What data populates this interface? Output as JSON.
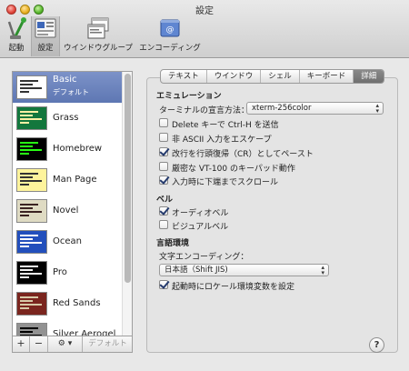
{
  "window": {
    "title": "設定"
  },
  "toolbar": {
    "items": [
      {
        "label": "起動"
      },
      {
        "label": "設定"
      },
      {
        "label": "ウインドウグループ"
      },
      {
        "label": "エンコーディング"
      }
    ]
  },
  "profiles": {
    "items": [
      {
        "name": "Basic",
        "subtitle": "デフォルト",
        "colors": {
          "bg": "#ffffff",
          "fg": "#333333"
        }
      },
      {
        "name": "Grass",
        "colors": {
          "bg": "#13773d",
          "fg": "#fff0a5"
        }
      },
      {
        "name": "Homebrew",
        "colors": {
          "bg": "#000000",
          "fg": "#28fe14"
        }
      },
      {
        "name": "Man Page",
        "colors": {
          "bg": "#fef49c",
          "fg": "#333333"
        }
      },
      {
        "name": "Novel",
        "colors": {
          "bg": "#dfdbc3",
          "fg": "#3b2322"
        }
      },
      {
        "name": "Ocean",
        "colors": {
          "bg": "#224fbc",
          "fg": "#ffffff"
        }
      },
      {
        "name": "Pro",
        "colors": {
          "bg": "#000000",
          "fg": "#f2f2f2"
        }
      },
      {
        "name": "Red Sands",
        "colors": {
          "bg": "#7a251e",
          "fg": "#d7c9a7"
        }
      },
      {
        "name": "Silver Aerogel",
        "colors": {
          "bg": "#929292",
          "fg": "#000000"
        }
      }
    ],
    "buttons": {
      "add": "+",
      "remove": "−",
      "gear": "⚙",
      "gear_arrow": "▾",
      "default": "デフォルト"
    }
  },
  "tabs": [
    {
      "label": "テキスト",
      "active": false
    },
    {
      "label": "ウインドウ",
      "active": false
    },
    {
      "label": "シェル",
      "active": false
    },
    {
      "label": "キーボード",
      "active": false
    },
    {
      "label": "詳細",
      "active": true
    }
  ],
  "emulation": {
    "heading": "エミュレーション",
    "terminal_type_label": "ターミナルの宣言方法：",
    "terminal_type_value": "xterm-256color",
    "options": [
      {
        "label": "Delete キーで Ctrl-H を送信",
        "checked": false
      },
      {
        "label": "非 ASCII 入力をエスケープ",
        "checked": false
      },
      {
        "label": "改行を行頭復帰（CR）としてペースト",
        "checked": true
      },
      {
        "label": "厳密な VT-100 のキーパッド動作",
        "checked": false
      },
      {
        "label": "入力時に下端までスクロール",
        "checked": true
      }
    ]
  },
  "bell": {
    "heading": "ベル",
    "options": [
      {
        "label": "オーディオベル",
        "checked": true
      },
      {
        "label": "ビジュアルベル",
        "checked": false
      }
    ]
  },
  "language": {
    "heading": "言語環境",
    "encoding_label": "文字エンコーディング：",
    "encoding_value": "日本語（Shift JIS)",
    "locale_option": {
      "label": "起動時にロケール環境変数を設定",
      "checked": true
    }
  },
  "help": {
    "label": "?"
  }
}
